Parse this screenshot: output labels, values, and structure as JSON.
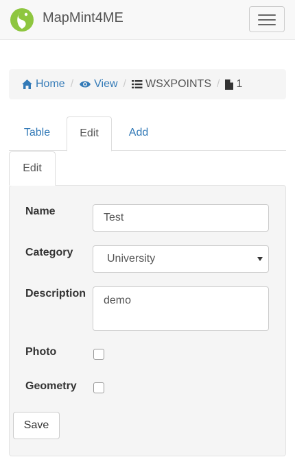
{
  "navbar": {
    "brand": "MapMint4ME",
    "logo_icon": "mapmint-logo-icon",
    "menu_icon": "hamburger-menu-icon",
    "brand_color": "#8ec63f"
  },
  "breadcrumb": {
    "home": {
      "label": "Home",
      "icon": "home-icon"
    },
    "view": {
      "label": "View",
      "icon": "eye-icon"
    },
    "table": {
      "label": "WSXPOINTS",
      "icon": "list-icon"
    },
    "record": {
      "label": "1",
      "icon": "file-icon"
    }
  },
  "tabs": [
    {
      "label": "Table",
      "active": false
    },
    {
      "label": "Edit",
      "active": true
    },
    {
      "label": "Add",
      "active": false
    }
  ],
  "subtab": {
    "label": "Edit"
  },
  "form": {
    "name": {
      "label": "Name",
      "value": "Test"
    },
    "category": {
      "label": "Category",
      "value": "University"
    },
    "description": {
      "label": "Description",
      "value": "demo"
    },
    "photo": {
      "label": "Photo",
      "checked": false
    },
    "geometry": {
      "label": "Geometry",
      "checked": false
    },
    "save_label": "Save"
  },
  "colors": {
    "link": "#337ab7",
    "panel": "#f5f5f5"
  }
}
